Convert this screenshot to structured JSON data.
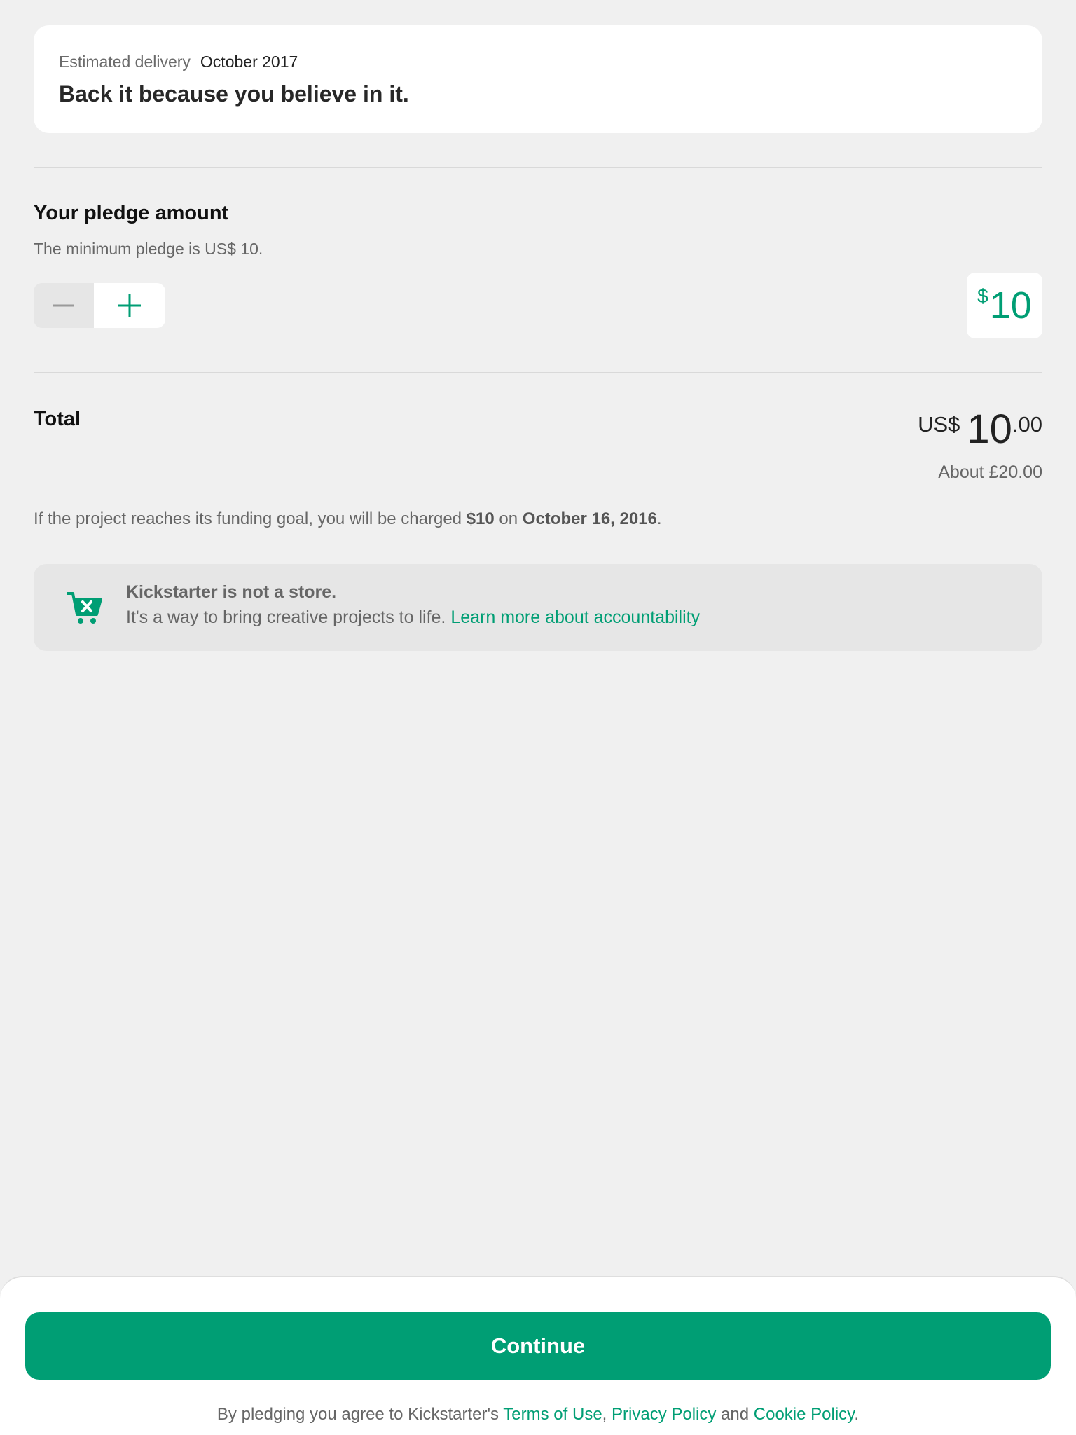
{
  "reward": {
    "delivery_label": "Estimated delivery",
    "delivery_value": "October 2017",
    "title": "Back it because you believe in it."
  },
  "pledge": {
    "title": "Your pledge amount",
    "min_note": "The minimum pledge is US$ 10.",
    "amount_symbol": "$",
    "amount_value": "10",
    "minus_icon": "minus-icon",
    "plus_icon": "plus-icon"
  },
  "total": {
    "label": "Total",
    "currency": "US$",
    "whole": "10",
    "cents": ".00",
    "approx": "About £20.00"
  },
  "charge_note": {
    "prefix": "If the project reaches its funding goal, you will be charged ",
    "amount": "$10",
    "middle": " on ",
    "date": "October 16, 2016",
    "suffix": "."
  },
  "notice": {
    "icon": "cart-x-icon",
    "title": "Kickstarter is not a store.",
    "body": "It's a way to bring creative projects to life. ",
    "link": "Learn more about accountability"
  },
  "footer": {
    "continue_label": "Continue",
    "legal_prefix": "By pledging you agree to Kickstarter's ",
    "terms": "Terms of Use",
    "comma": ", ",
    "privacy": "Privacy Policy",
    "and": " and ",
    "cookie": "Cookie Policy",
    "period": "."
  },
  "colors": {
    "accent": "#009e74",
    "background": "#f0f0f0",
    "muted_text": "#666666"
  }
}
